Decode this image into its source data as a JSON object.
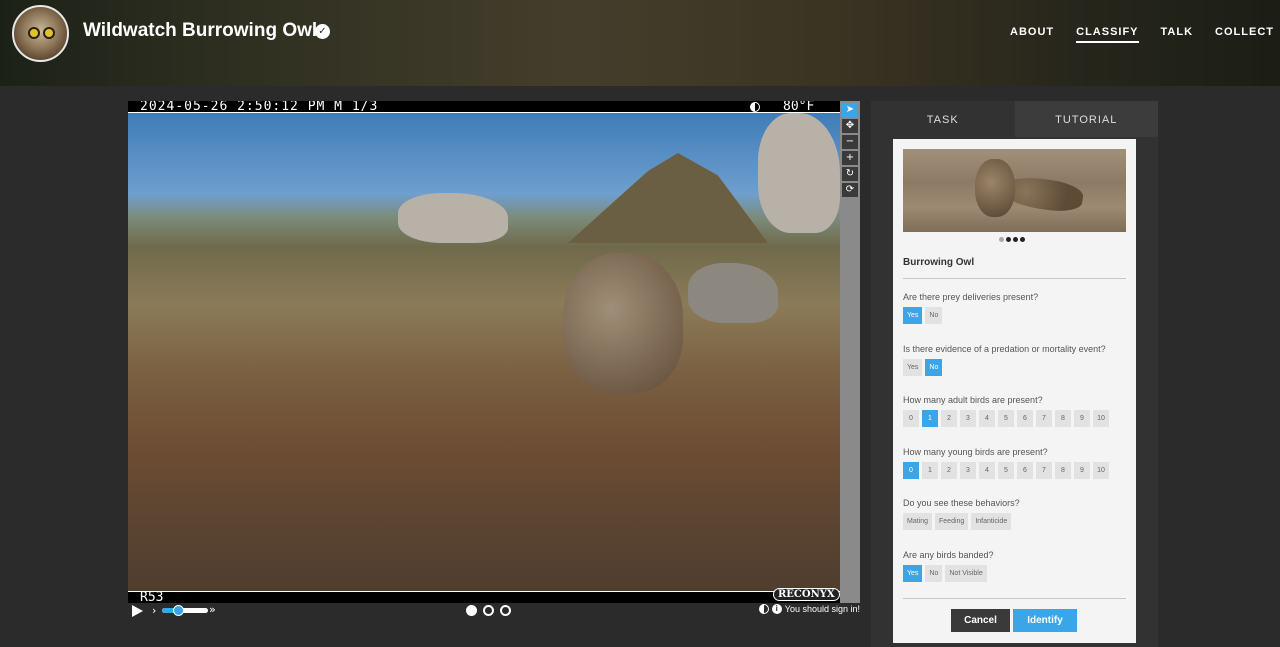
{
  "header": {
    "title": "Wildwatch Burrowing Owl",
    "verified_icon": "check-circle-icon",
    "nav": [
      {
        "label": "ABOUT",
        "active": false
      },
      {
        "label": "CLASSIFY",
        "active": true
      },
      {
        "label": "TALK",
        "active": false
      },
      {
        "label": "COLLECT",
        "active": false
      }
    ]
  },
  "viewer": {
    "datetime": "2024-05-26  2:50:12 PM  M 1/3",
    "temperature": "80°F",
    "camera_id": "R53",
    "brand": "RECONYX",
    "tools": [
      "pointer-icon",
      "move-icon",
      "zoom-out-icon",
      "zoom-in-icon",
      "rotate-icon",
      "reset-icon"
    ],
    "frames": [
      {
        "on": true
      },
      {
        "on": false
      },
      {
        "on": false
      }
    ],
    "playback_speed": 0.35,
    "speed_slow": "›",
    "speed_fast": "»",
    "sign_in_text": "You should sign in!"
  },
  "panel": {
    "tabs": [
      "TASK",
      "TUTORIAL"
    ],
    "species": "Burrowing Owl",
    "questions": [
      {
        "text": "Are there prey deliveries present?",
        "options": [
          "Yes",
          "No"
        ],
        "selected": [
          0
        ]
      },
      {
        "text": "Is there evidence of a predation or mortality event?",
        "options": [
          "Yes",
          "No"
        ],
        "selected": [
          1
        ]
      },
      {
        "text": "How many adult birds are present?",
        "options": [
          "0",
          "1",
          "2",
          "3",
          "4",
          "5",
          "6",
          "7",
          "8",
          "9",
          "10"
        ],
        "selected": [
          1
        ]
      },
      {
        "text": "How many young birds are present?",
        "options": [
          "0",
          "1",
          "2",
          "3",
          "4",
          "5",
          "6",
          "7",
          "8",
          "9",
          "10"
        ],
        "selected": [
          0
        ]
      },
      {
        "text": "Do you see these behaviors?",
        "options": [
          "Mating",
          "Feeding",
          "Infanticide"
        ],
        "selected": []
      },
      {
        "text": "Are any birds banded?",
        "options": [
          "Yes",
          "No",
          "Not Visible"
        ],
        "selected": [
          0
        ]
      }
    ],
    "cancel_label": "Cancel",
    "identify_label": "Identify"
  }
}
